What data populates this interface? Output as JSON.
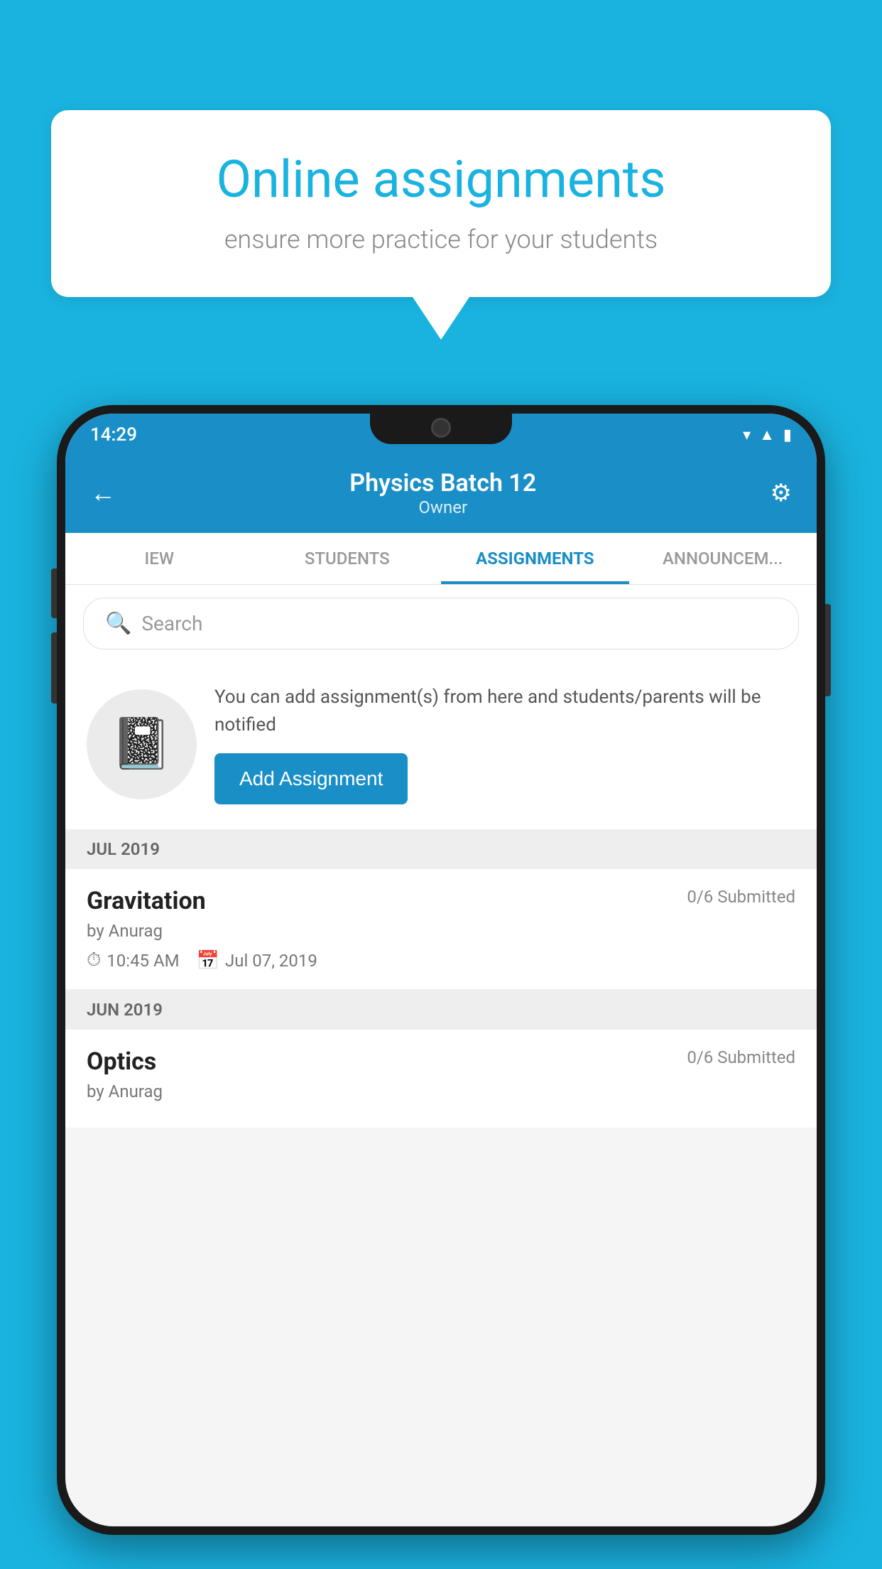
{
  "background": {
    "color": "#1ab3e0"
  },
  "speech_bubble": {
    "title": "Online assignments",
    "subtitle": "ensure more practice for your students"
  },
  "status_bar": {
    "time": "14:29",
    "icons": [
      "wifi",
      "signal",
      "battery"
    ]
  },
  "header": {
    "title": "Physics Batch 12",
    "subtitle": "Owner",
    "back_label": "←",
    "settings_label": "⚙"
  },
  "tabs": [
    {
      "label": "IEW",
      "active": false
    },
    {
      "label": "STUDENTS",
      "active": false
    },
    {
      "label": "ASSIGNMENTS",
      "active": true
    },
    {
      "label": "ANNOUNCEM...",
      "active": false
    }
  ],
  "search": {
    "placeholder": "Search"
  },
  "info_card": {
    "text": "You can add assignment(s) from here and students/parents will be notified",
    "add_button_label": "Add Assignment"
  },
  "sections": [
    {
      "label": "JUL 2019",
      "assignments": [
        {
          "name": "Gravitation",
          "submitted": "0/6 Submitted",
          "author": "by Anurag",
          "time": "10:45 AM",
          "date": "Jul 07, 2019"
        }
      ]
    },
    {
      "label": "JUN 2019",
      "assignments": [
        {
          "name": "Optics",
          "submitted": "0/6 Submitted",
          "author": "by Anurag",
          "time": "",
          "date": ""
        }
      ]
    }
  ]
}
